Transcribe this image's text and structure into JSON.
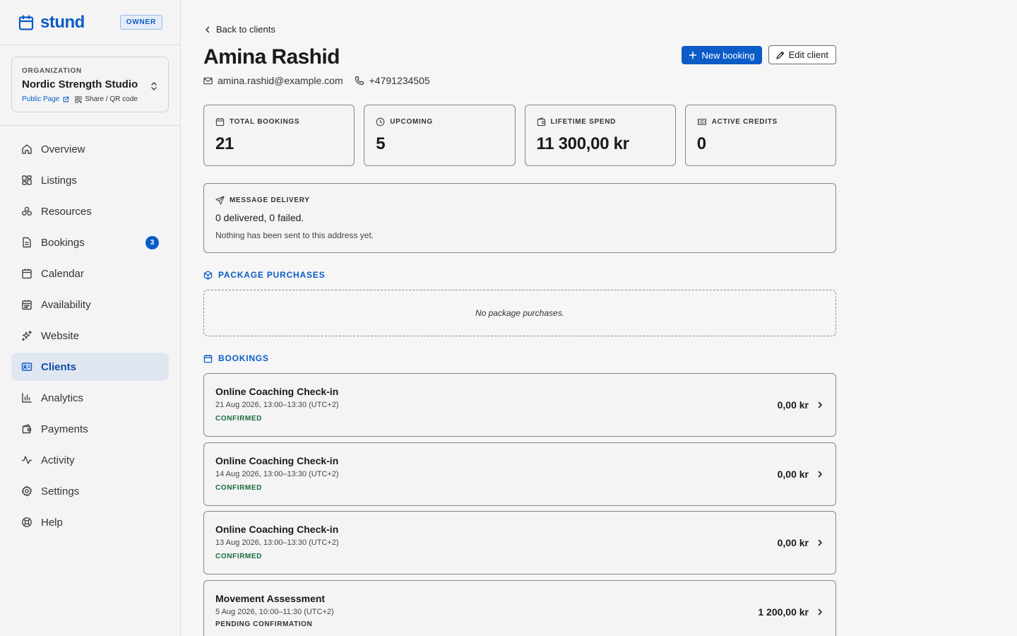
{
  "brand": {
    "name": "stund",
    "role_badge": "OWNER"
  },
  "organization": {
    "label": "ORGANIZATION",
    "name": "Nordic Strength Studio",
    "public_page": "Public Page",
    "share": "Share / QR code"
  },
  "nav": {
    "items": [
      {
        "label": "Overview",
        "icon": "home-icon"
      },
      {
        "label": "Listings",
        "icon": "grid-icon"
      },
      {
        "label": "Resources",
        "icon": "resources-icon"
      },
      {
        "label": "Bookings",
        "icon": "document-icon",
        "badge": "3"
      },
      {
        "label": "Calendar",
        "icon": "calendar-icon"
      },
      {
        "label": "Availability",
        "icon": "calendar-grid-icon"
      },
      {
        "label": "Website",
        "icon": "sparkles-icon"
      },
      {
        "label": "Clients",
        "icon": "id-card-icon",
        "active": true
      },
      {
        "label": "Analytics",
        "icon": "bar-chart-icon"
      },
      {
        "label": "Payments",
        "icon": "wallet-icon"
      },
      {
        "label": "Activity",
        "icon": "activity-icon"
      },
      {
        "label": "Settings",
        "icon": "gear-icon"
      },
      {
        "label": "Help",
        "icon": "lifebuoy-icon"
      }
    ]
  },
  "client": {
    "back_label": "Back to clients",
    "name": "Amina Rashid",
    "email": "amina.rashid@example.com",
    "phone": "+4791234505",
    "new_booking_label": "New booking",
    "edit_label": "Edit client"
  },
  "stats": [
    {
      "label": "TOTAL BOOKINGS",
      "value": "21",
      "icon": "calendar-icon"
    },
    {
      "label": "UPCOMING",
      "value": "5",
      "icon": "clock-icon"
    },
    {
      "label": "LIFETIME SPEND",
      "value": "11 300,00 kr",
      "icon": "wallet-icon"
    },
    {
      "label": "ACTIVE CREDITS",
      "value": "0",
      "icon": "ticket-icon"
    }
  ],
  "delivery": {
    "label": "MESSAGE DELIVERY",
    "summary": "0 delivered, 0 failed.",
    "note": "Nothing has been sent to this address yet."
  },
  "packages": {
    "title": "PACKAGE PURCHASES",
    "empty": "No package purchases."
  },
  "bookings": {
    "title": "BOOKINGS",
    "items": [
      {
        "title": "Online Coaching Check-in",
        "date": "21 Aug 2026, 13:00–13:30 (UTC+2)",
        "status": "CONFIRMED",
        "price": "0,00 kr"
      },
      {
        "title": "Online Coaching Check-in",
        "date": "14 Aug 2026, 13:00–13:30 (UTC+2)",
        "status": "CONFIRMED",
        "price": "0,00 kr"
      },
      {
        "title": "Online Coaching Check-in",
        "date": "13 Aug 2026, 13:00–13:30 (UTC+2)",
        "status": "CONFIRMED",
        "price": "0,00 kr"
      },
      {
        "title": "Movement Assessment",
        "date": "5 Aug 2026, 10:00–11:30 (UTC+2)",
        "status": "PENDING CONFIRMATION",
        "price": "1 200,00 kr"
      }
    ]
  },
  "colors": {
    "accent": "#0b5cc7",
    "confirmed": "#176b3b",
    "sidebar_active": "#e1e7f0"
  }
}
